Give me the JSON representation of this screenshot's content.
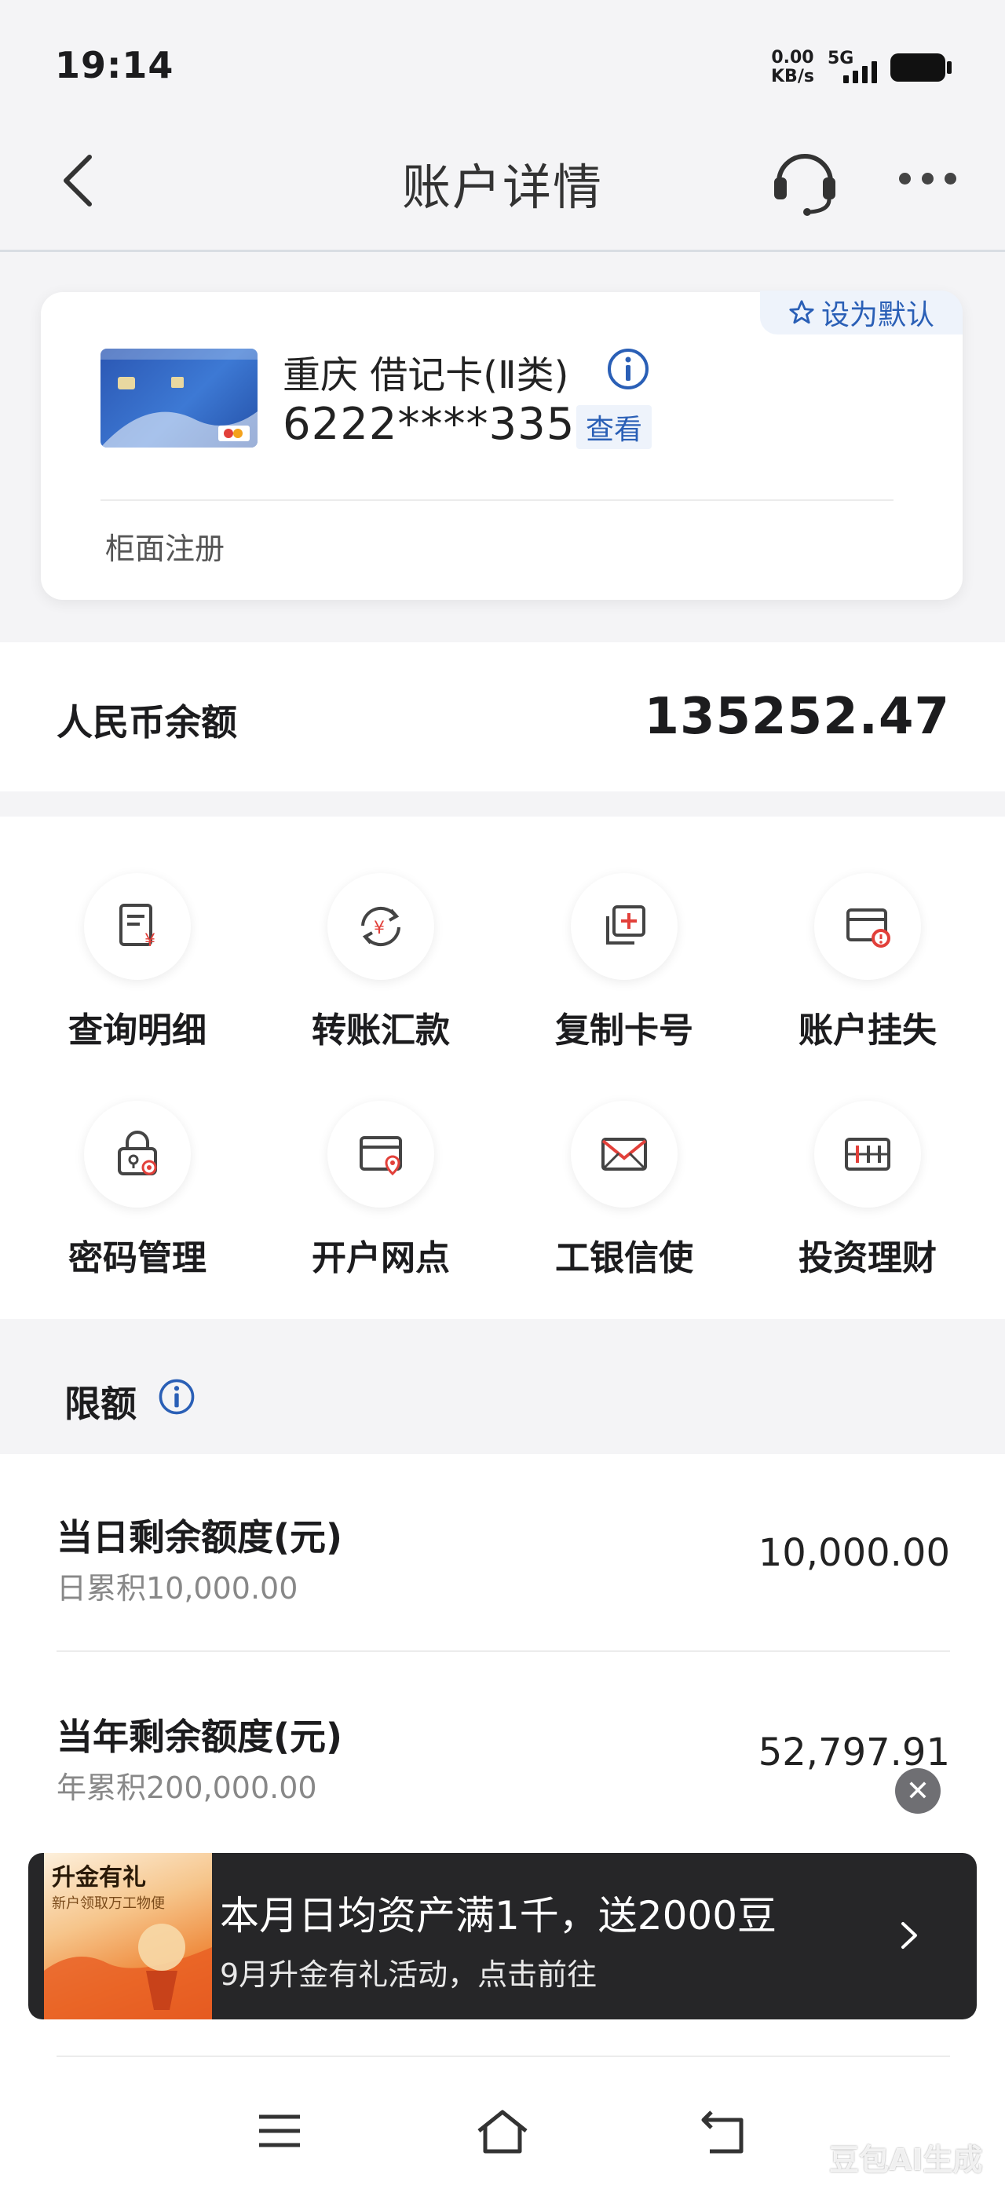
{
  "status_bar": {
    "time": "19:14",
    "net_speed_value": "0.00",
    "net_speed_unit": "KB/s",
    "network": "5G"
  },
  "header": {
    "title": "账户详情"
  },
  "card": {
    "set_default_label": "设为默认",
    "name": "重庆 借记卡(Ⅱ类)",
    "number": "6222****3350",
    "view_label": "查看",
    "registration": "柜面注册"
  },
  "balance": {
    "label": "人民币余额",
    "value": "135252.47"
  },
  "functions": [
    {
      "label": "查询明细",
      "icon": "statement-icon"
    },
    {
      "label": "转账汇款",
      "icon": "transfer-icon"
    },
    {
      "label": "复制卡号",
      "icon": "copy-icon"
    },
    {
      "label": "账户挂失",
      "icon": "report-loss-icon"
    },
    {
      "label": "密码管理",
      "icon": "password-icon"
    },
    {
      "label": "开户网点",
      "icon": "branch-location-icon"
    },
    {
      "label": "工银信使",
      "icon": "envelope-icon"
    },
    {
      "label": "投资理财",
      "icon": "investment-icon"
    }
  ],
  "limits": {
    "title": "限额",
    "rows": [
      {
        "title": "当日剩余额度(元)",
        "sub": "日累积10,000.00",
        "value": "10,000.00"
      },
      {
        "title": "当年剩余额度(元)",
        "sub": "年累积200,000.00",
        "value": "52,797.91"
      }
    ]
  },
  "banner": {
    "image_title": "升金有礼",
    "image_sub": "新户领取万工物便",
    "title": "本月日均资产满1千，送2000豆",
    "subtitle": "9月升金有礼活动，点击前往"
  },
  "watermark": "豆包AI生成",
  "colors": {
    "accent_blue": "#2a5fb6",
    "icon_red": "#e2403a",
    "banner_bg": "#262628"
  }
}
